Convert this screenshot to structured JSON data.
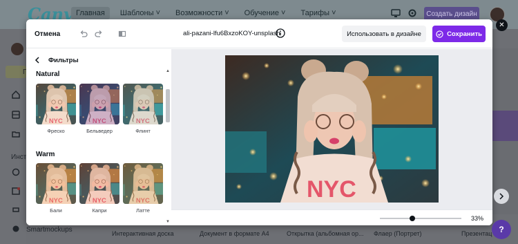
{
  "background": {
    "logo": "Canva",
    "nav": [
      {
        "label": "Главная",
        "active": true
      },
      {
        "label": "Шаблоны ˅",
        "active": false
      },
      {
        "label": "Возможности ˅",
        "active": false
      },
      {
        "label": "Обучение ˅",
        "active": false
      },
      {
        "label": "Тарифы ˅",
        "active": false
      }
    ],
    "create_button": "Создать дизайн",
    "sidebar_label_1": "П",
    "sidebar_label_2": "Инст",
    "sidebar_smartmockups": "Smartmockups",
    "bottom_items": [
      "Интерактивная доска",
      "Документ в формате А4",
      "Открытка (альбомная ор...",
      "Флаер (Портрет)",
      "Презентац"
    ]
  },
  "modal": {
    "cancel_label": "Отмена",
    "file_name": "ali-pazani-lfu6BxzoKOY-unsplash",
    "use_in_design_label": "Использовать в дизайне",
    "save_label": "Сохранить",
    "panel_title": "Фильтры",
    "sections": [
      {
        "title": "Natural",
        "filters": [
          "Фреско",
          "Бельведер",
          "Флинт"
        ]
      },
      {
        "title": "Warm",
        "filters": [
          "Бали",
          "Капри",
          "Латте"
        ]
      }
    ],
    "zoom_value": "33%",
    "zoom_level": 0.33
  },
  "icons": {
    "undo": "undo-icon",
    "redo": "redo-icon",
    "compare": "compare-icon",
    "info": "info-icon",
    "save": "check-circle-icon",
    "back": "chevron-left-icon",
    "close": "close-icon",
    "next": "chevron-right-icon"
  },
  "colors": {
    "accent": "#7d2ae8",
    "close_button": "#0e1318"
  }
}
